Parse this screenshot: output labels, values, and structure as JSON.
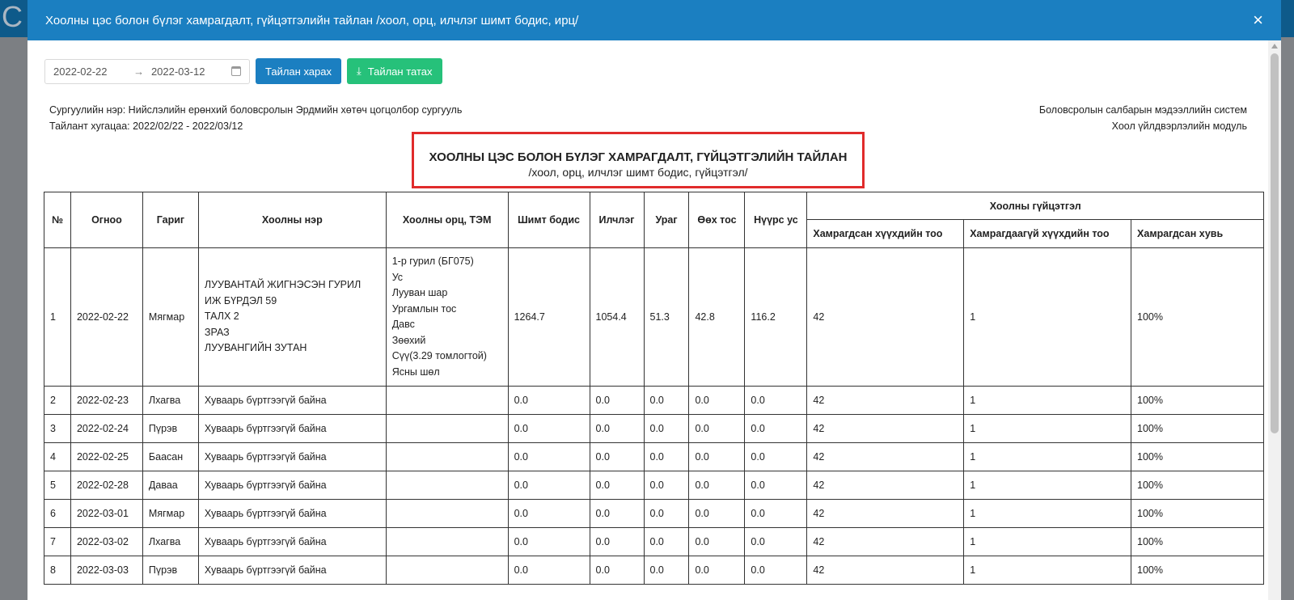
{
  "modal": {
    "title": "Хоолны цэс болон бүлэг хамрагдалт, гүйцэтгэлийн тайлан /хоол, орц, илчлэг шимт бодис, ирц/",
    "close_label": "×"
  },
  "filters": {
    "date_from": "2022-02-22",
    "date_arrow": "→",
    "date_to": "2022-03-12",
    "view_button": "Тайлан харах",
    "download_button": "Тайлан татах"
  },
  "info": {
    "school": "Сургуулийн нэр: Нийслэлийн ерөнхий боловсролын Эрдмийн хөтөч цогцолбор сургууль",
    "period": "Тайлант хугацаа: 2022/02/22 - 2022/03/12",
    "system": "Боловсролын салбарын мэдээллийн систем",
    "module": "Хоол үйлдвэрлэлийн модуль"
  },
  "report": {
    "title": "ХООЛНЫ ЦЭС БОЛОН БҮЛЭГ ХАМРАГДАЛТ, ГҮЙЦЭТГЭЛИЙН ТАЙЛАН",
    "subtitle": "/хоол, орц, илчлэг шимт бодис, гүйцэтгэл/"
  },
  "table": {
    "headers": {
      "no": "№",
      "date": "Огноо",
      "day": "Гариг",
      "food": "Хоолны нэр",
      "ingredients": "Хоолны орц, ТЭМ",
      "nutrient": "Шимт бодис",
      "calorie": "Илчлэг",
      "protein": "Ураг",
      "fat": "Өөх тос",
      "carb": "Нүүрс ус",
      "performance": "Хоолны гүйцэтгэл",
      "covered": "Хамрагдсан хүүхдийн тоо",
      "not_covered": "Хамрагдаагүй хүүхдийн тоо",
      "rate": "Хамрагдсан хувь"
    },
    "rows": [
      {
        "no": "1",
        "date": "2022-02-22",
        "day": "Мягмар",
        "food": [
          "ЛУУВАНТАЙ ЖИГНЭСЭН ГУРИЛ",
          "ИЖ БҮРДЭЛ 59",
          "ТАЛХ 2",
          "ЗРАЗ",
          "ЛУУВАНГИЙН ЗУТАН"
        ],
        "ingredients": [
          "1-р гурил (БГ075)",
          "Ус",
          "Лууван шар",
          "Ургамлын тос",
          "Давс",
          "Зөөхий",
          "Сүү(3.29 томлогтой)",
          "Ясны шөл"
        ],
        "nutrient": "1264.7",
        "calorie": "1054.4",
        "protein": "51.3",
        "fat": "42.8",
        "carb": "116.2",
        "covered": "42",
        "not_covered": "1",
        "rate": "100%"
      },
      {
        "no": "2",
        "date": "2022-02-23",
        "day": "Лхагва",
        "food": [
          "Хуваарь бүртгээгүй байна"
        ],
        "ingredients": [],
        "nutrient": "0.0",
        "calorie": "0.0",
        "protein": "0.0",
        "fat": "0.0",
        "carb": "0.0",
        "covered": "42",
        "not_covered": "1",
        "rate": "100%"
      },
      {
        "no": "3",
        "date": "2022-02-24",
        "day": "Пүрэв",
        "food": [
          "Хуваарь бүртгээгүй байна"
        ],
        "ingredients": [],
        "nutrient": "0.0",
        "calorie": "0.0",
        "protein": "0.0",
        "fat": "0.0",
        "carb": "0.0",
        "covered": "42",
        "not_covered": "1",
        "rate": "100%"
      },
      {
        "no": "4",
        "date": "2022-02-25",
        "day": "Баасан",
        "food": [
          "Хуваарь бүртгээгүй байна"
        ],
        "ingredients": [],
        "nutrient": "0.0",
        "calorie": "0.0",
        "protein": "0.0",
        "fat": "0.0",
        "carb": "0.0",
        "covered": "42",
        "not_covered": "1",
        "rate": "100%"
      },
      {
        "no": "5",
        "date": "2022-02-28",
        "day": "Даваа",
        "food": [
          "Хуваарь бүртгээгүй байна"
        ],
        "ingredients": [],
        "nutrient": "0.0",
        "calorie": "0.0",
        "protein": "0.0",
        "fat": "0.0",
        "carb": "0.0",
        "covered": "42",
        "not_covered": "1",
        "rate": "100%"
      },
      {
        "no": "6",
        "date": "2022-03-01",
        "day": "Мягмар",
        "food": [
          "Хуваарь бүртгээгүй байна"
        ],
        "ingredients": [],
        "nutrient": "0.0",
        "calorie": "0.0",
        "protein": "0.0",
        "fat": "0.0",
        "carb": "0.0",
        "covered": "42",
        "not_covered": "1",
        "rate": "100%"
      },
      {
        "no": "7",
        "date": "2022-03-02",
        "day": "Лхагва",
        "food": [
          "Хуваарь бүртгээгүй байна"
        ],
        "ingredients": [],
        "nutrient": "0.0",
        "calorie": "0.0",
        "protein": "0.0",
        "fat": "0.0",
        "carb": "0.0",
        "covered": "42",
        "not_covered": "1",
        "rate": "100%"
      },
      {
        "no": "8",
        "date": "2022-03-03",
        "day": "Пүрэв",
        "food": [
          "Хуваарь бүртгээгүй байна"
        ],
        "ingredients": [],
        "nutrient": "0.0",
        "calorie": "0.0",
        "protein": "0.0",
        "fat": "0.0",
        "carb": "0.0",
        "covered": "42",
        "not_covered": "1",
        "rate": "100%"
      }
    ]
  },
  "icons": {
    "calendar": "calendar-icon",
    "download": "download-icon",
    "close": "close-icon"
  },
  "colors": {
    "header_blue": "#1b7fc1",
    "download_green": "#26c17a",
    "highlight_red": "#e02b2b"
  }
}
